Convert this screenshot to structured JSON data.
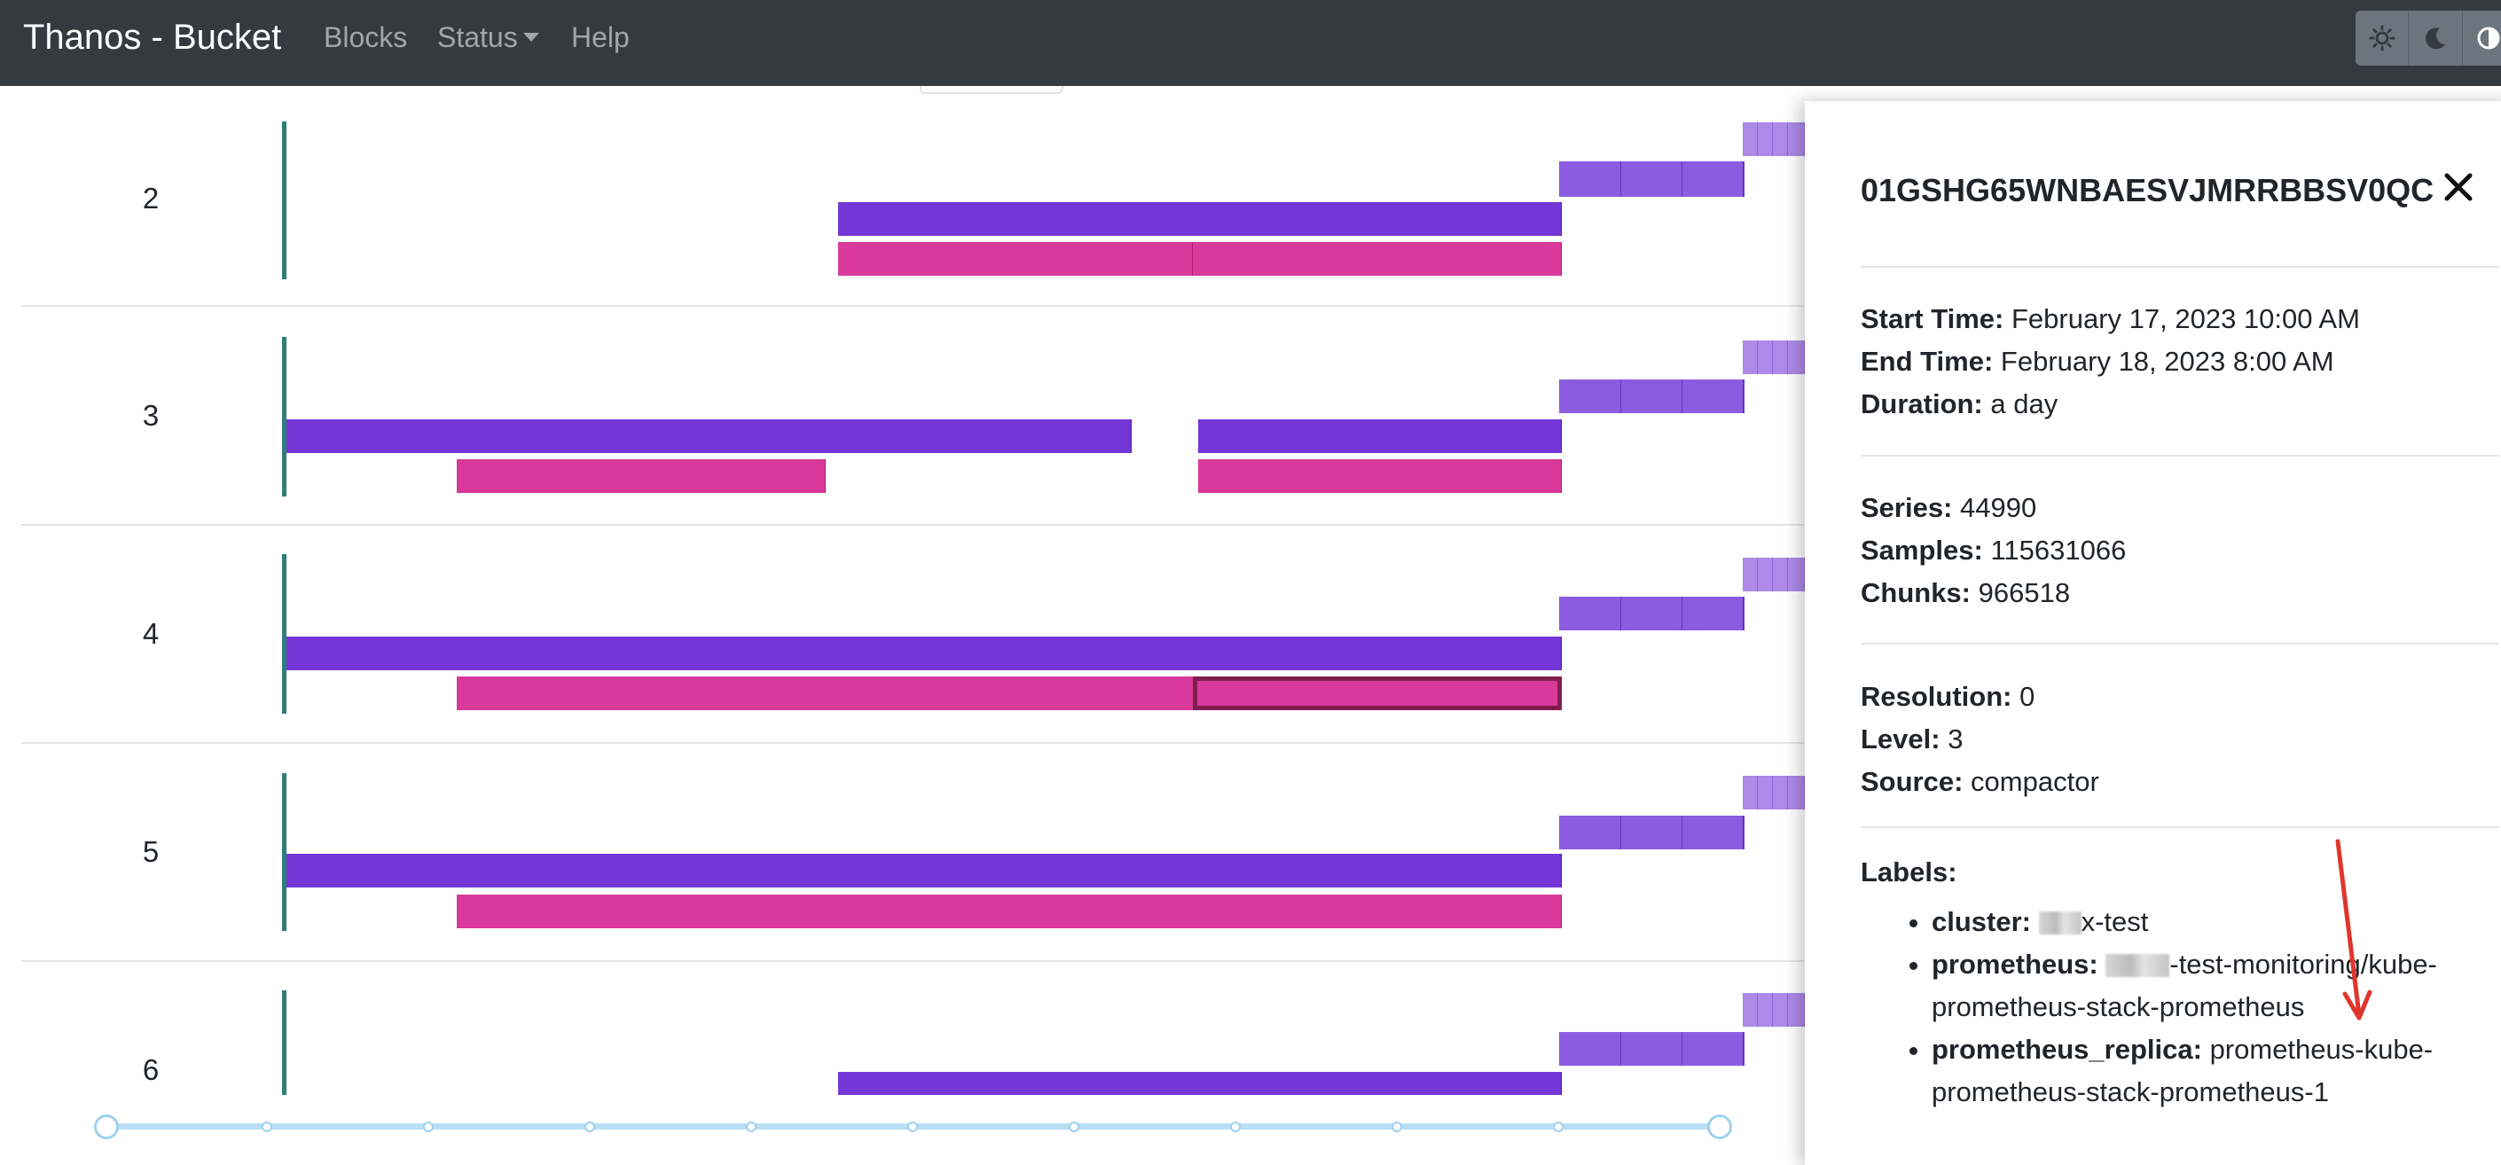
{
  "navbar": {
    "brand": "Thanos - Bucket",
    "links": [
      {
        "label": "Blocks"
      },
      {
        "label": "Status",
        "has_dropdown": true
      },
      {
        "label": "Help"
      }
    ],
    "theme_buttons": [
      "sun-icon",
      "moon-icon",
      "half-circle-icon"
    ]
  },
  "timeline": {
    "rows": [
      {
        "label": "2"
      },
      {
        "label": "3"
      },
      {
        "label": "4"
      },
      {
        "label": "5"
      },
      {
        "label": "6"
      }
    ],
    "colors": {
      "compacted_level_3": "#7436d6",
      "compacted_level_4": "#d9399a",
      "compacted_level_2": "#8c5ce0",
      "raw": "#ad8ae8",
      "row_axis": "#2e7e7b",
      "slider": "#b9dff5"
    }
  },
  "panel": {
    "title": "01GSHG65WNBAESVJMRRBBSV0QC",
    "start_time": {
      "label": "Start Time:",
      "value": "February 17, 2023 10:00 AM"
    },
    "end_time": {
      "label": "End Time:",
      "value": "February 18, 2023 8:00 AM"
    },
    "duration": {
      "label": "Duration:",
      "value": "a day"
    },
    "series": {
      "label": "Series:",
      "value": "44990"
    },
    "samples": {
      "label": "Samples:",
      "value": "115631066"
    },
    "chunks": {
      "label": "Chunks:",
      "value": "966518"
    },
    "resolution": {
      "label": "Resolution:",
      "value": "0"
    },
    "level": {
      "label": "Level:",
      "value": "3"
    },
    "source": {
      "label": "Source:",
      "value": "compactor"
    },
    "labels_heading": "Labels:",
    "labels": [
      {
        "key": "cluster:",
        "value": "x-test"
      },
      {
        "key": "prometheus:",
        "value": "-test-monitoring/kube-prometheus-stack-prometheus"
      },
      {
        "key": "prometheus_replica:",
        "value": "prometheus-kube-prometheus-stack-prometheus-1"
      }
    ]
  },
  "annotation": {
    "arrow_color": "#e0352b"
  }
}
